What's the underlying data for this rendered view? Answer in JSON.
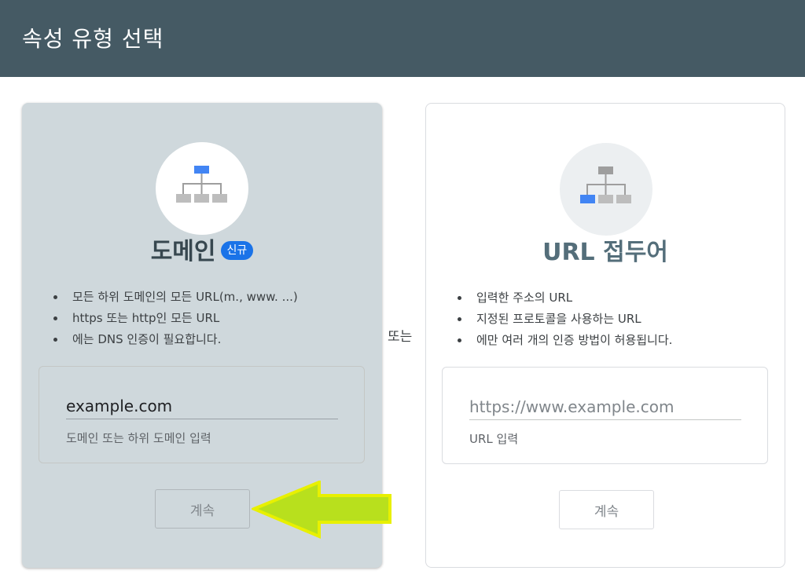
{
  "header": {
    "title": "속성 유형 선택"
  },
  "or_label": "또는",
  "domain_card": {
    "title": "도메인",
    "badge": "신규",
    "features": [
      "모든 하위 도메인의 모든 URL(m., www. ...)",
      "https 또는 http인 모든 URL",
      "에는 DNS 인증이 필요합니다."
    ],
    "input_value": "example.com",
    "input_help": "도메인 또는 하위 도메인 입력",
    "continue_label": "계속",
    "icon": "domain-hierarchy-icon"
  },
  "url_card": {
    "title": "URL 접두어",
    "features": [
      "입력한 주소의 URL",
      "지정된 프로토콜을 사용하는 URL",
      "에만 여러 개의 인증 방법이 허용됩니다."
    ],
    "input_placeholder": "https://www.example.com",
    "input_help": "URL 입력",
    "continue_label": "계속",
    "icon": "url-prefix-hierarchy-icon"
  },
  "colors": {
    "header_bg": "#455a64",
    "domain_card_bg": "#cfd8dc",
    "accent_blue": "#4285f4",
    "badge_blue": "#1a73e8",
    "arrow_fill": "#b8e01d",
    "arrow_stroke": "#e8f000"
  }
}
